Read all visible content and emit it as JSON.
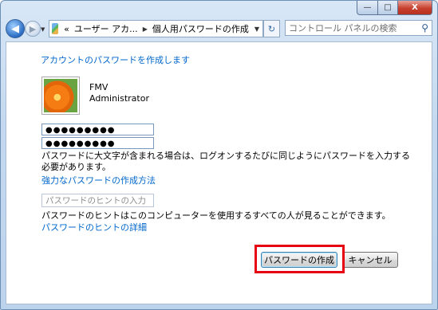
{
  "window": {
    "close_label": "X",
    "max_label": "□",
    "min_label": "—"
  },
  "nav": {
    "breadcrumb": [
      "«",
      "ユーザー アカ...",
      "個人用パスワードの作成"
    ],
    "search_placeholder": "コントロール パネルの検索"
  },
  "content": {
    "heading": "アカウントのパスワードを作成します",
    "user": {
      "name": "FMV",
      "role": "Administrator"
    },
    "password": "●●●●●●●●●",
    "confirm_password": "●●●●●●●●●",
    "case_warning": "パスワードに大文字が含まれる場合は、ログオンするたびに同じようにパスワードを入力する必要があります。",
    "strong_password_link": "強力なパスワードの作成方法",
    "hint_placeholder": "パスワードのヒントの入力",
    "hint_notice": "パスワードのヒントはこのコンピューターを使用するすべての人が見ることができます。",
    "hint_details_link": "パスワードのヒントの詳細"
  },
  "buttons": {
    "create": "パスワードの作成",
    "cancel": "キャンセル"
  },
  "colors": {
    "highlight": "#e60012",
    "link": "#0066cc"
  }
}
